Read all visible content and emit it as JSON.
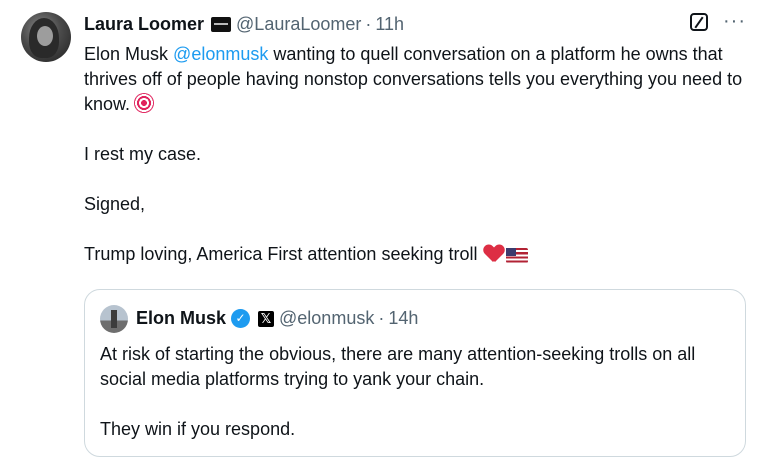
{
  "tweet": {
    "author": {
      "display_name": "Laura Loomer",
      "handle": "@LauraLoomer",
      "separator": "·",
      "time": "11h",
      "affiliation_badge_icon": "affiliation-badge-icon"
    },
    "body": {
      "line1_prefix": "Elon Musk ",
      "line1_mention": "@elonmusk",
      "line1_rest": " wanting to quell conversation on a platform he owns that thrives off of people having nonstop conversations tells you everything you need to know.",
      "line1_emoji": "target-emoji",
      "line2": "I rest my case.",
      "line3": "Signed,",
      "line4": "Trump loving, America First attention seeking troll",
      "line4_emojis": [
        "red-heart-emoji",
        "us-flag-emoji"
      ]
    },
    "icons": {
      "edit": "edit-icon",
      "more": "···"
    }
  },
  "quoted_tweet": {
    "author": {
      "display_name": "Elon Musk",
      "verified_icon": "✓",
      "affiliation_icon": "𝕏",
      "handle": "@elonmusk",
      "separator": "·",
      "time": "14h"
    },
    "body": {
      "paragraph1": "At risk of starting the obvious, there are many attention-seeking trolls on all social media platforms trying to yank your chain.",
      "paragraph2": "They win if you respond."
    }
  },
  "colors": {
    "text": "#0f1419",
    "secondary": "#536471",
    "link": "#1d9bf0",
    "border": "#cfd9de"
  }
}
